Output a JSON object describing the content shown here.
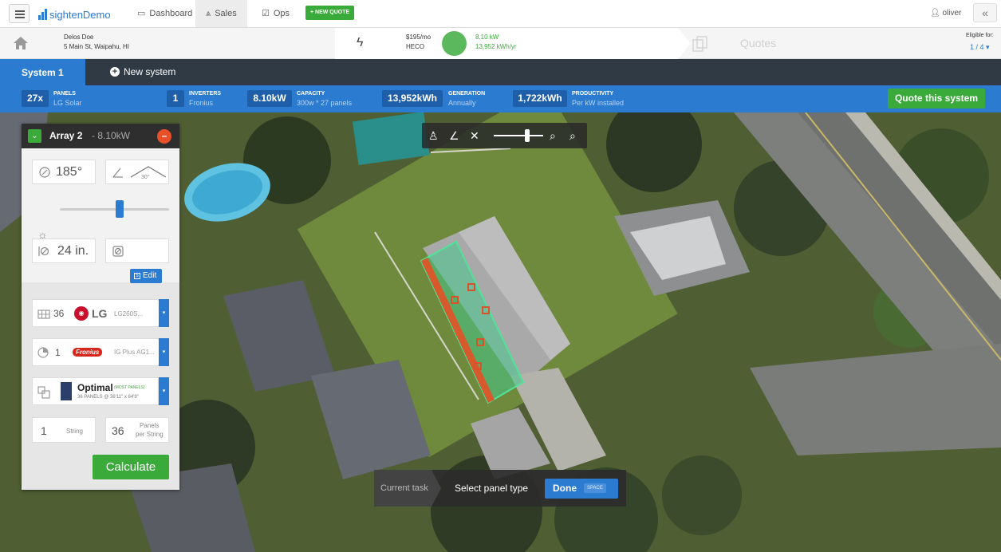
{
  "nav": {
    "logo_text": "sightenDemo",
    "dashboard": "Dashboard",
    "sales": "Sales",
    "ops": "Ops",
    "new_quote": "+ NEW QUOTE",
    "user": "oliver",
    "collapse": "«"
  },
  "customer": {
    "name": "Delos Doe",
    "address": "5 Main St, Waipahu, HI",
    "price": "$195/mo",
    "utility": "HECO",
    "power": "8.10 kW",
    "energy": "13,952 kWh/yr",
    "quotes_label": "Quotes",
    "eligible_label": "Eligible for:",
    "eligible_count": "1 / 4 ▾"
  },
  "system_tabs": {
    "active": "System 1",
    "new_system": "New system"
  },
  "stats": {
    "panels_value": "27x",
    "panels_label": "PANELS",
    "panels_sub": "LG Solar",
    "inverters_value": "1",
    "inverters_label": "INVERTERS",
    "inverters_sub": "Fronius",
    "capacity_value": "8.10kW",
    "capacity_label": "CAPACITY",
    "capacity_sub": "300w * 27 panels",
    "generation_value": "13,952kWh",
    "generation_label": "GENERATION",
    "generation_sub": "Annually",
    "productivity_value": "1,722kWh",
    "productivity_label": "PRODUCTIVITY",
    "productivity_sub": "Per kW installed",
    "quote_button": "Quote this system"
  },
  "array_panel": {
    "title": "Array 2",
    "power": "- 8.10kW",
    "azimuth": "185°",
    "tilt": "30°",
    "setback": "24 in.",
    "obstructions_count": "5",
    "edit_label": "Edit",
    "panel_count": "36",
    "panel_brand": "LG",
    "panel_model": "LG260S...",
    "inverter_count": "1",
    "inverter_brand": "Fronius",
    "inverter_model": "IG Plus AG1...",
    "layout_name": "Optimal",
    "layout_tag": "(MOST PANELS)",
    "layout_detail": "36 PANELS @ 36'11\" x 64'9\"",
    "strings_value": "1",
    "strings_label": "String",
    "panels_per_string_value": "36",
    "panels_per_string_label_1": "Panels",
    "panels_per_string_label_2": "per String",
    "calculate": "Calculate",
    "sun_exposure": 0.55
  },
  "task": {
    "current_label": "Current task",
    "text": "Select panel type",
    "done": "Done",
    "shortcut": "SPACE"
  },
  "map_zoom": 0.7,
  "colors": {
    "accent_blue": "#2b7bd1",
    "green": "#3aaa3a",
    "dark_nav": "#2f3a45",
    "danger": "#e8502a"
  }
}
